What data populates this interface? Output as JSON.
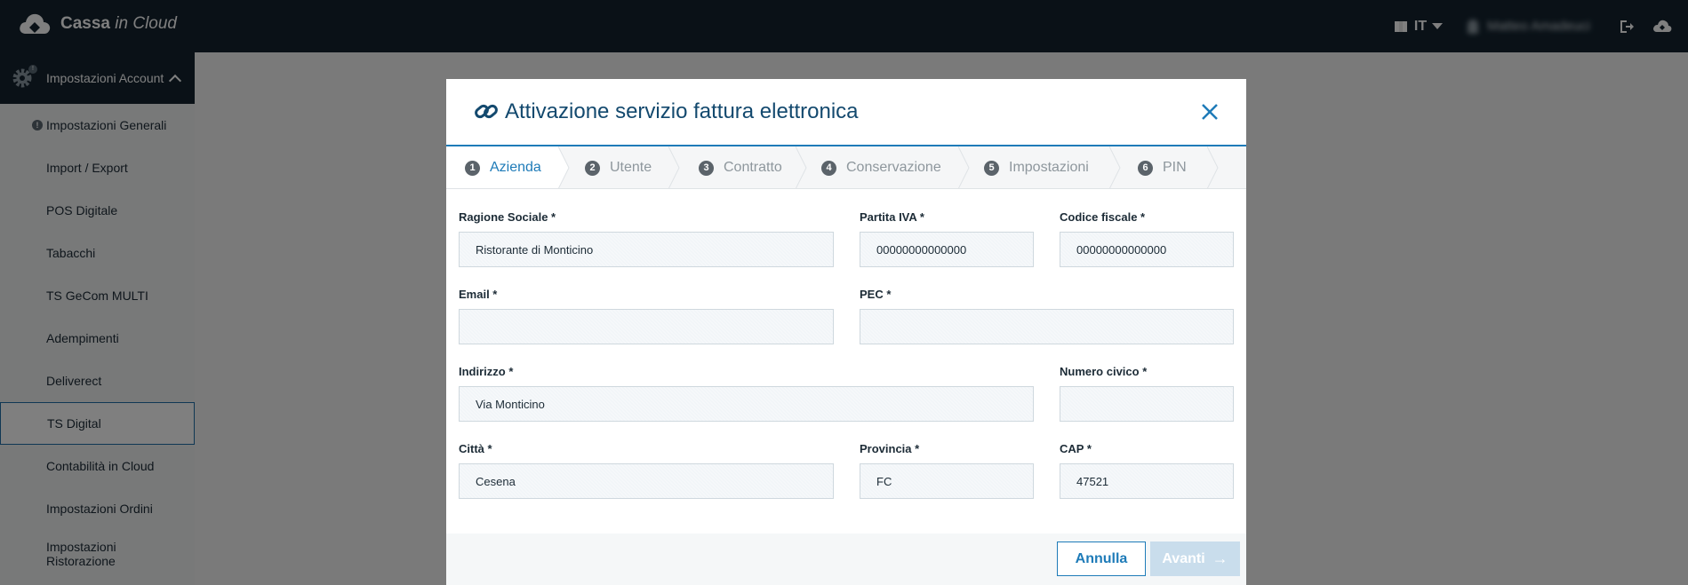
{
  "app": {
    "logo_bold": "Cassa",
    "logo_light": " in Cloud"
  },
  "topbar": {
    "language": "IT",
    "user_name": "Matteo Amadeuci"
  },
  "sidebar": {
    "header": "Impostazioni Account",
    "items": [
      {
        "label": "Impostazioni Generali"
      },
      {
        "label": "Import / Export"
      },
      {
        "label": "POS Digitale"
      },
      {
        "label": "Tabacchi"
      },
      {
        "label": "TS GeCom MULTI"
      },
      {
        "label": "Adempimenti"
      },
      {
        "label": "Deliverect"
      },
      {
        "label": "TS Digital"
      },
      {
        "label": "Contabilità in Cloud"
      },
      {
        "label": "Impostazioni Ordini"
      },
      {
        "label_line1": "Impostazioni",
        "label_line2": "Ristorazione"
      }
    ]
  },
  "modal": {
    "title": "Attivazione servizio fattura elettronica",
    "steps": [
      {
        "num": "1",
        "label": "Azienda"
      },
      {
        "num": "2",
        "label": "Utente"
      },
      {
        "num": "3",
        "label": "Contratto"
      },
      {
        "num": "4",
        "label": "Conservazione"
      },
      {
        "num": "5",
        "label": "Impostazioni"
      },
      {
        "num": "6",
        "label": "PIN"
      }
    ],
    "fields": {
      "ragione_sociale": {
        "label": "Ragione Sociale *",
        "value": "Ristorante di Monticino"
      },
      "partita_iva": {
        "label": "Partita IVA *",
        "value": "00000000000000"
      },
      "codice_fiscale": {
        "label": "Codice fiscale *",
        "value": "00000000000000"
      },
      "email": {
        "label": "Email *",
        "value": ""
      },
      "pec": {
        "label": "PEC *",
        "value": ""
      },
      "indirizzo": {
        "label": "Indirizzo *",
        "value": "Via Monticino"
      },
      "numero_civico": {
        "label": "Numero civico *",
        "value": ""
      },
      "citta": {
        "label": "Città *",
        "value": "Cesena"
      },
      "provincia": {
        "label": "Provincia *",
        "value": "FC"
      },
      "cap": {
        "label": "CAP *",
        "value": "47521"
      }
    },
    "buttons": {
      "cancel": "Annulla",
      "next": "Avanti"
    }
  },
  "colors": {
    "accent": "#1e7bb8",
    "topbar": "#14232f",
    "title": "#13496e"
  }
}
